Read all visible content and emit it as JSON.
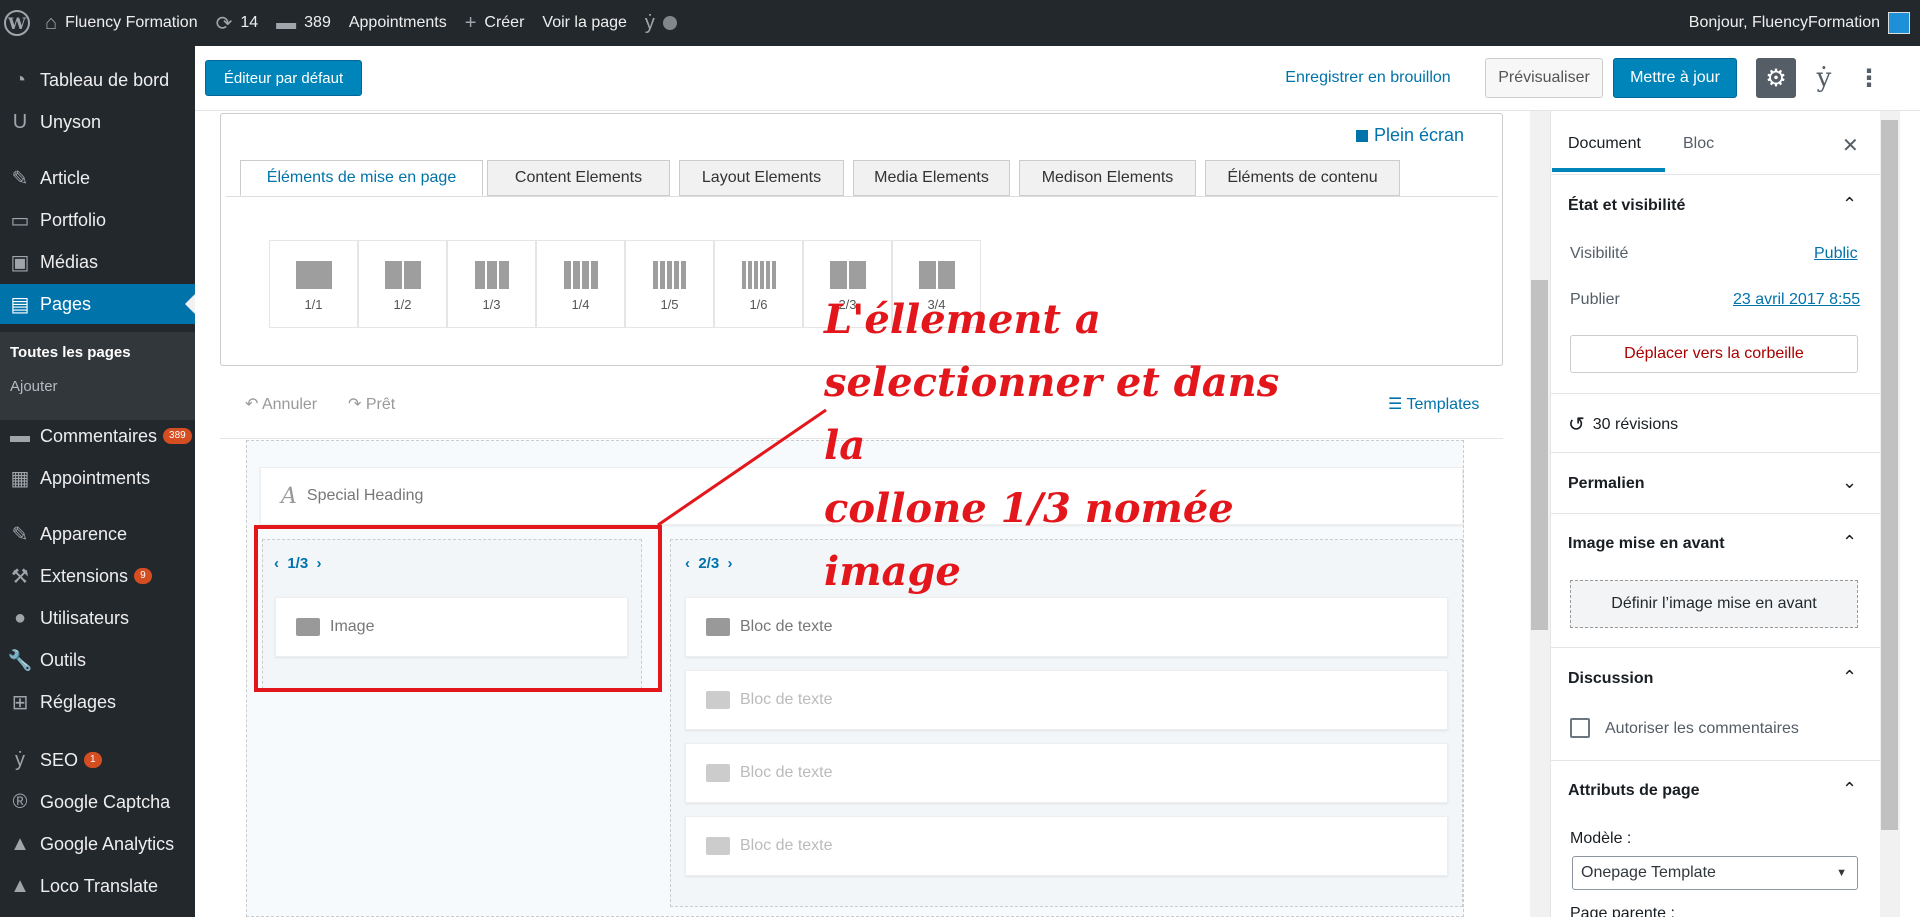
{
  "adminbar": {
    "site_name": "Fluency Formation",
    "updates_count": "14",
    "comments_count": "389",
    "appointments": "Appointments",
    "create": "Créer",
    "view_page": "Voir la page",
    "greeting": "Bonjour, FluencyFormation"
  },
  "sidebar": {
    "items": [
      {
        "label": "Tableau de bord",
        "icon": "dashboard-icon"
      },
      {
        "label": "Unyson",
        "icon": "unyson-icon"
      },
      {
        "label": "Article",
        "icon": "pin-icon"
      },
      {
        "label": "Portfolio",
        "icon": "folder-icon"
      },
      {
        "label": "Médias",
        "icon": "media-icon"
      },
      {
        "label": "Pages",
        "icon": "pages-icon"
      },
      {
        "label": "Commentaires",
        "icon": "comment-icon",
        "badge": "389"
      },
      {
        "label": "Appointments",
        "icon": "calendar-icon"
      },
      {
        "label": "Apparence",
        "icon": "brush-icon"
      },
      {
        "label": "Extensions",
        "icon": "plugin-icon",
        "badge": "9"
      },
      {
        "label": "Utilisateurs",
        "icon": "user-icon"
      },
      {
        "label": "Outils",
        "icon": "wrench-icon"
      },
      {
        "label": "Réglages",
        "icon": "settings-icon"
      },
      {
        "label": "SEO",
        "icon": "yoast-icon",
        "badge": "1"
      },
      {
        "label": "Google Captcha",
        "icon": "captcha-icon"
      },
      {
        "label": "Google Analytics",
        "icon": "analytics-icon"
      },
      {
        "label": "Loco Translate",
        "icon": "translate-icon"
      }
    ],
    "submenu": [
      "Toutes les pages",
      "Ajouter"
    ]
  },
  "header": {
    "default_editor": "Éditeur par défaut",
    "save_draft": "Enregistrer en brouillon",
    "preview": "Prévisualiser",
    "update": "Mettre à jour"
  },
  "builder": {
    "fullscreen": "Plein écran",
    "tabs": [
      "Éléments de mise en page",
      "Content Elements",
      "Layout Elements",
      "Media Elements",
      "Medison Elements",
      "Éléments de contenu"
    ],
    "layouts": [
      {
        "label": "1/1",
        "cols": 1
      },
      {
        "label": "1/2",
        "cols": 2
      },
      {
        "label": "1/3",
        "cols": 3
      },
      {
        "label": "1/4",
        "cols": 4
      },
      {
        "label": "1/5",
        "cols": 5
      },
      {
        "label": "1/6",
        "cols": 6
      },
      {
        "label": "2/3",
        "cols": 2
      },
      {
        "label": "3/4",
        "cols": 2
      }
    ],
    "undo": "Annuler",
    "redo": "Prêt",
    "templates": "Templates",
    "special_heading": "Special Heading",
    "col1_label": "1/3",
    "col2_label": "2/3",
    "image_element": "Image",
    "text_blocks": [
      "Bloc de texte",
      "Bloc de texte",
      "Bloc de texte",
      "Bloc de texte"
    ]
  },
  "annotation": {
    "lines": [
      "L'éllement a",
      "selectionner et dans la",
      "collone 1/3 nomée",
      "image"
    ]
  },
  "panel": {
    "tab_document": "Document",
    "tab_block": "Bloc",
    "status_title": "État et visibilité",
    "visibility_label": "Visibilité",
    "visibility_value": "Public",
    "publish_label": "Publier",
    "publish_value": "23 avril 2017 8:55",
    "trash": "Déplacer vers la corbeille",
    "revisions": "30 révisions",
    "permalink": "Permalien",
    "featured_title": "Image mise en avant",
    "featured_button": "Définir l’image mise en avant",
    "discussion_title": "Discussion",
    "allow_comments": "Autoriser les commentaires",
    "attributes_title": "Attributs de page",
    "template_label": "Modèle :",
    "template_value": "Onepage Template",
    "parent_label": "Page parente :"
  }
}
